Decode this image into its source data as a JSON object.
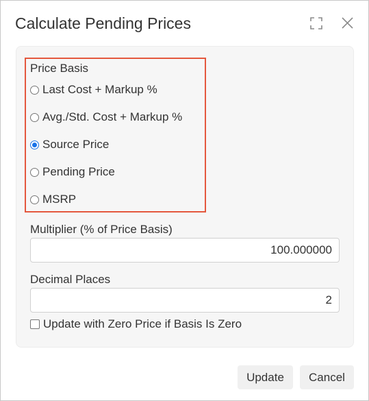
{
  "dialog": {
    "title": "Calculate Pending Prices"
  },
  "price_basis": {
    "label": "Price Basis",
    "options": [
      {
        "label": "Last Cost + Markup %",
        "checked": false
      },
      {
        "label": "Avg./Std. Cost + Markup %",
        "checked": false
      },
      {
        "label": "Source Price",
        "checked": true
      },
      {
        "label": "Pending Price",
        "checked": false
      },
      {
        "label": "MSRP",
        "checked": false
      }
    ]
  },
  "multiplier": {
    "label": "Multiplier (% of Price Basis)",
    "value": "100.000000"
  },
  "decimal_places": {
    "label": "Decimal Places",
    "value": "2"
  },
  "zero_price": {
    "label": "Update with Zero Price if Basis Is Zero",
    "checked": false
  },
  "buttons": {
    "update": "Update",
    "cancel": "Cancel"
  },
  "colors": {
    "highlight": "#e4573d",
    "radio_selected": "#1a73e8"
  },
  "icons": {
    "maximize": "maximize-icon",
    "close": "close-icon"
  }
}
